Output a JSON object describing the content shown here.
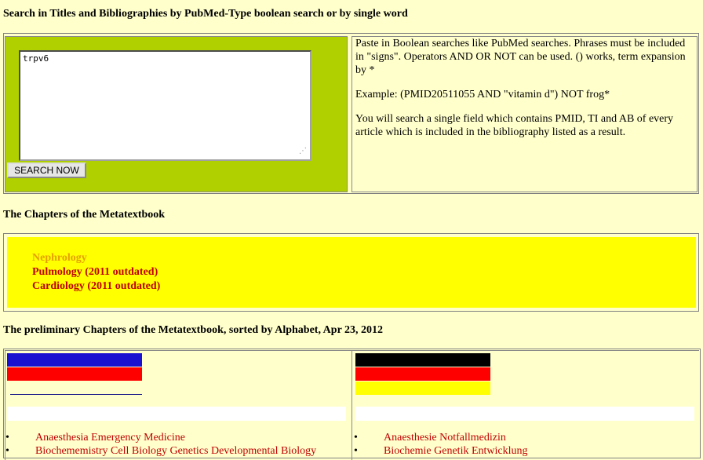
{
  "search": {
    "heading": "Search in Titles and Bibliographies by PubMed-Type boolean search or by single word",
    "query_value": "trpv6",
    "button_label": "SEARCH NOW",
    "help_paragraph_1": "Paste in Boolean searches like PubMed searches. Phrases must be included in \"signs\". Operators AND OR NOT can be used. () works, term expansion by *",
    "help_paragraph_2": "Example: (PMID20511055 AND \"vitamin d\") NOT frog*",
    "help_paragraph_3": "You will search a single field which contains PMID, TI and AB of every article which is included in the bibliography listed as a result."
  },
  "chapters": {
    "heading": "The Chapters of the Metatextbook",
    "items": [
      {
        "label": "Nephrology",
        "color": "#e6a000"
      },
      {
        "label": "Pulmology (2011 outdated)",
        "color": "#c00000"
      },
      {
        "label": "Cardiology (2011 outdated)",
        "color": "#c00000"
      }
    ]
  },
  "preliminary": {
    "heading": "The preliminary Chapters of the Metatextbook, sorted by Alphabet, Apr 23, 2012",
    "english": {
      "flag_colors": [
        "#1a10d0",
        "#ff0000",
        "#ffffff"
      ],
      "items": [
        "Anaesthesia Emergency Medicine",
        "Biochememistry Cell Biology Genetics Developmental Biology"
      ]
    },
    "german": {
      "flag_colors": [
        "#000000",
        "#ff0000",
        "#ffff00"
      ],
      "items": [
        "Anaesthesie Notfallmedizin",
        "Biochemie Genetik Entwicklung"
      ]
    }
  },
  "colors": {
    "page_background": "#ffffcc",
    "search_panel": "#b0d000",
    "chapters_panel": "#ffff00",
    "link_red": "#c00000"
  }
}
